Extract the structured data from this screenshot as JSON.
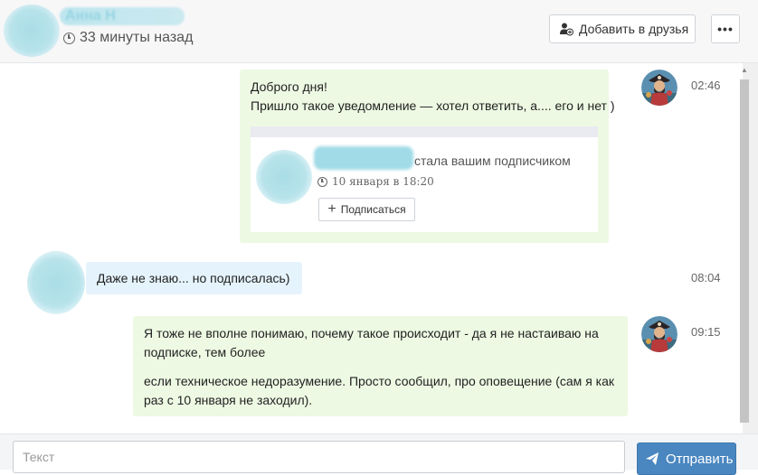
{
  "header": {
    "name": "Анна Н",
    "last_seen": "33 минуты назад",
    "add_friend_label": "Добавить в друзья",
    "more_label": "•••"
  },
  "messages": [
    {
      "direction": "out",
      "time": "02:46",
      "lines": [
        "Доброго дня!",
        "Пришло такое уведомление — хотел ответить, а.... его и нет )"
      ],
      "attachment": {
        "text": "стала вашим подписчиком",
        "date": "10 января в 18:20",
        "button": "Подписаться"
      }
    },
    {
      "direction": "in",
      "time": "08:04",
      "lines": [
        "Даже не знаю... но подписалась)"
      ]
    },
    {
      "direction": "out",
      "time": "09:15",
      "paragraphs": [
        "Я тоже не вполне понимаю, почему такое происходит - да я не настаиваю на подписке, тем более",
        "если техническое недоразумение. Просто сообщил, про оповещение (сам я как раз с 10 января не заходил)."
      ]
    }
  ],
  "compose": {
    "placeholder": "Текст",
    "send_label": "Отправить"
  },
  "colors": {
    "outgoing_bubble": "#edf9e3",
    "incoming_bubble": "#e5f3fc",
    "send_button": "#4a87c0"
  }
}
